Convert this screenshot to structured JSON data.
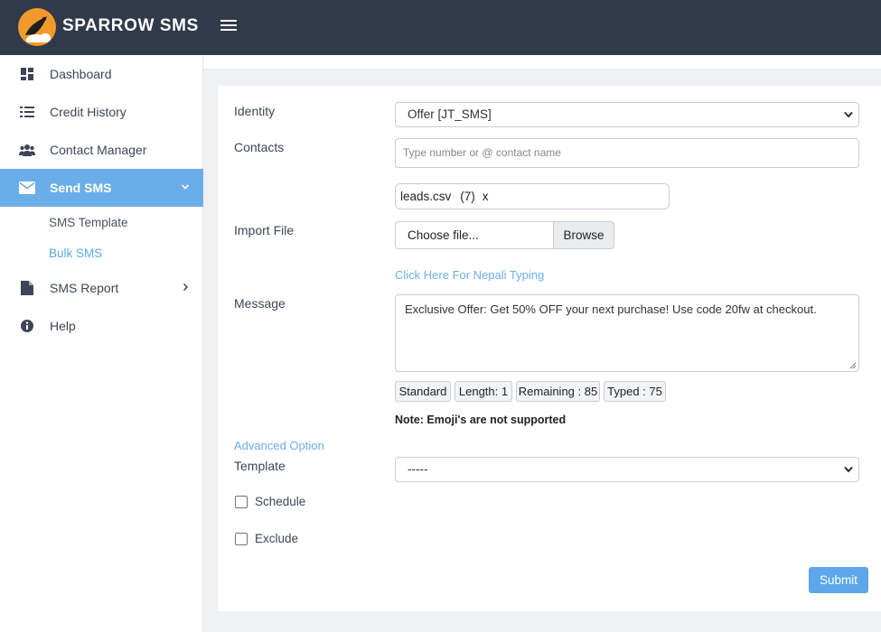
{
  "header": {
    "brand": "SPARROW SMS"
  },
  "sidebar": {
    "items": [
      {
        "label": "Dashboard"
      },
      {
        "label": "Credit History"
      },
      {
        "label": "Contact Manager"
      },
      {
        "label": "Send SMS"
      },
      {
        "label": "SMS Report"
      },
      {
        "label": "Help"
      }
    ],
    "sub_items": [
      {
        "label": "SMS Template"
      },
      {
        "label": "Bulk SMS"
      }
    ]
  },
  "form": {
    "identity_label": "Identity",
    "identity_value": "Offer [JT_SMS]",
    "contacts_label": "Contacts",
    "contacts_placeholder": "Type number or @ contact name",
    "file_chip": {
      "name": "leads.csv",
      "count": "(7)",
      "remove": "x"
    },
    "import_label": "Import File",
    "choose_file": "Choose file...",
    "browse": "Browse",
    "nepali_link": "Click Here For Nepali Typing",
    "message_label": "Message",
    "message_value": "Exclusive Offer: Get 50% OFF your next purchase! Use code 20fw at checkout.",
    "badges": {
      "type": "Standard",
      "length": "Length: 1",
      "remaining": "Remaining : 85",
      "typed": "Typed : 75"
    },
    "note": "Note: Emoji's are not supported",
    "advanced_link": "Advanced Option",
    "template_label": "Template",
    "template_value": "-----",
    "schedule_label": "Schedule",
    "exclude_label": "Exclude",
    "submit": "Submit"
  },
  "colors": {
    "header_bg": "#2f3a4a",
    "accent": "#6aaee9",
    "submit_bg": "#5ba7ea"
  },
  "icons": [
    "sparrow-logo",
    "hamburger-icon",
    "dashboard-icon",
    "list-icon",
    "users-icon",
    "envelope-icon",
    "chevron-down-icon",
    "file-icon",
    "chevron-right-icon",
    "info-icon"
  ]
}
